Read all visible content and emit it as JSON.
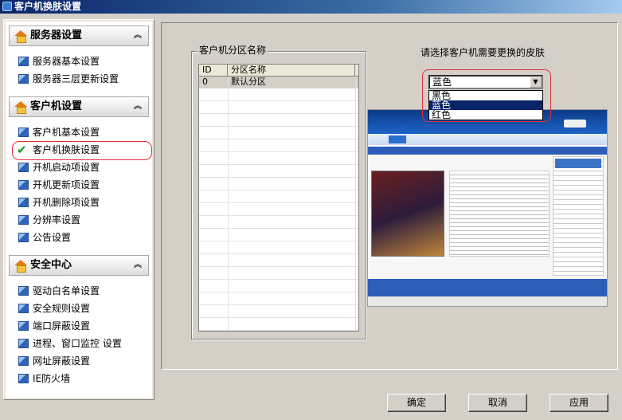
{
  "window": {
    "title": "客户机换肤设置"
  },
  "sidebar": {
    "sections": [
      {
        "title": "服务器设置",
        "collapse": "︽",
        "items": [
          {
            "label": "服务器基本设置"
          },
          {
            "label": "服务器三层更新设置"
          }
        ]
      },
      {
        "title": "客户机设置",
        "collapse": "︽",
        "items": [
          {
            "label": "客户机基本设置"
          },
          {
            "label": "客户机换肤设置"
          },
          {
            "label": "开机启动项设置"
          },
          {
            "label": "开机更新项设置"
          },
          {
            "label": "开机删除项设置"
          },
          {
            "label": "分辨率设置"
          },
          {
            "label": "公告设置"
          }
        ]
      },
      {
        "title": "安全中心",
        "collapse": "︽",
        "items": [
          {
            "label": "驱动白名单设置"
          },
          {
            "label": "安全规则设置"
          },
          {
            "label": "端口屏蔽设置"
          },
          {
            "label": "进程、窗口监控 设置"
          },
          {
            "label": "网址屏蔽设置"
          },
          {
            "label": "IE防火墙"
          }
        ]
      }
    ],
    "selected_item": "客户机换肤设置"
  },
  "partition": {
    "group_title": "客户机分区名称",
    "columns": [
      "ID",
      "分区名称"
    ],
    "rows": [
      {
        "id": "0",
        "name": "默认分区"
      }
    ]
  },
  "skin": {
    "label": "请选择客户机需要更换的皮肤",
    "selected": "蓝色",
    "options": [
      "黑色",
      "蓝色",
      "红色"
    ],
    "highlighted": "蓝色"
  },
  "buttons": {
    "ok": "确定",
    "cancel": "取消",
    "apply": "应用"
  },
  "colors": {
    "highlight": "#0a246a",
    "callout_red": "#e0303a",
    "check_green": "#1a9a1a"
  }
}
